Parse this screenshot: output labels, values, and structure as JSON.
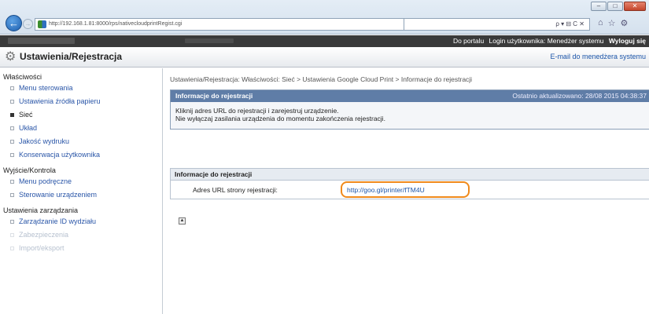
{
  "browser": {
    "url": "http://192.168.1.81:8000/rps/nativecloudprintRegist.cgi",
    "toolbar_text": "ρ ▾ ⊟ C ✕"
  },
  "topbar": {
    "portal_link": "Do portalu",
    "user_label": "Login użytkownika: Menedżer systemu",
    "logout": "Wyloguj się"
  },
  "header": {
    "title": "Ustawienia/Rejestracja",
    "email_link": "E-mail do menedżera systemu"
  },
  "sidebar": {
    "section1": "Właściwości",
    "items1": [
      "Menu sterowania",
      "Ustawienia źródła papieru",
      "Sieć",
      "Układ",
      "Jakość wydruku",
      "Konserwacja użytkownika"
    ],
    "section2": "Wyjście/Kontrola",
    "items2": [
      "Menu podręczne",
      "Sterowanie urządzeniem"
    ],
    "section3": "Ustawienia zarządzania",
    "items3": [
      "Zarządzanie ID wydziału",
      "Zabezpieczenia",
      "Import/eksport"
    ]
  },
  "main": {
    "breadcrumb": "Ustawienia/Rejestracja: Właściwości: Sieć > Ustawienia Google Cloud Print > Informacje do rejestracji",
    "panel1": {
      "title": "Informacje do rejestracji",
      "updated": "Ostatnio aktualizowano: 28/08 2015 04:38:37",
      "line1": "Kliknij adres URL do rejestracji i zarejestruj urządzenie.",
      "line2": "Nie wyłączaj zasilania urządzenia do momentu zakończenia rejestracji."
    },
    "panel2": {
      "title": "Informacje do rejestracji",
      "label": "Adres URL strony rejestracji:",
      "value": "http://goo.gl/printer/fTM4U"
    }
  },
  "colors": {
    "accent_orange": "#f08a1c",
    "panel_header_blue": "#5f7da7",
    "link_blue": "#1b54a8"
  }
}
